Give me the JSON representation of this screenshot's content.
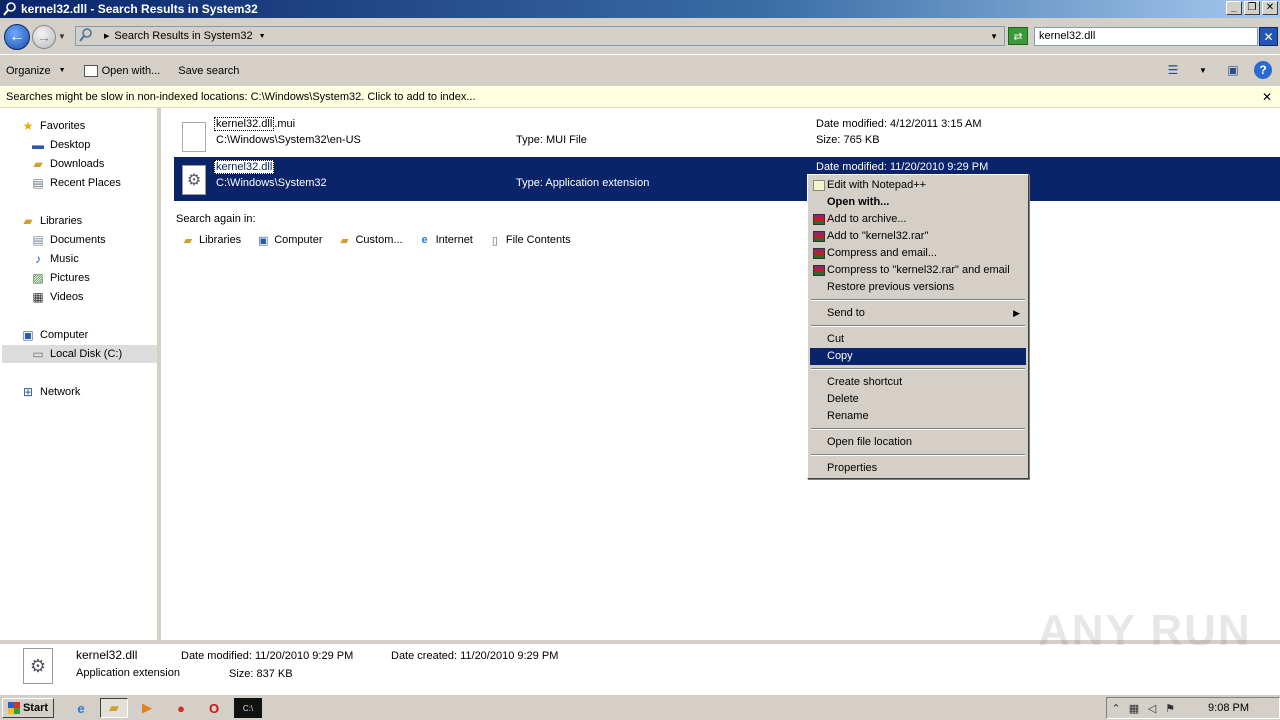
{
  "window": {
    "title": "kernel32.dll - Search Results in System32",
    "buttons": {
      "minimize": "_",
      "maximize": "❐",
      "close": "✕"
    }
  },
  "address": {
    "crumb": "Search Results in System32",
    "search_value": "kernel32.dll"
  },
  "toolbar": {
    "organize": "Organize",
    "open_with": "Open with...",
    "save_search": "Save search"
  },
  "infobar": {
    "text": "Searches might be slow in non-indexed locations: C:\\Windows\\System32. Click to add to index...",
    "close": "✕"
  },
  "nav": {
    "favorites": "Favorites",
    "desktop": "Desktop",
    "downloads": "Downloads",
    "recent_places": "Recent Places",
    "libraries": "Libraries",
    "documents": "Documents",
    "music": "Music",
    "pictures": "Pictures",
    "videos": "Videos",
    "computer": "Computer",
    "local_disk": "Local Disk (C:)",
    "network": "Network"
  },
  "results": [
    {
      "name_match": "kernel32.dll",
      "name_rest": ".mui",
      "path": "C:\\Windows\\System32\\en-US",
      "type": "Type: MUI File",
      "date": "Date modified: 4/12/2011 3:15 AM",
      "size": "Size: 765 KB"
    },
    {
      "name_match": "kernel32.dll",
      "name_rest": "",
      "path": "C:\\Windows\\System32",
      "type": "Type: Application extension",
      "date": "Date modified: 11/20/2010 9:29 PM",
      "size": ""
    }
  ],
  "search_again": {
    "label": "Search again in:",
    "libraries": "Libraries",
    "computer": "Computer",
    "custom": "Custom...",
    "internet": "Internet",
    "file_contents": "File Contents"
  },
  "context_menu": {
    "edit_npp": "Edit with Notepad++",
    "open_with": "Open with...",
    "add_archive": "Add to archive...",
    "add_rar": "Add to \"kernel32.rar\"",
    "compress_email": "Compress and email...",
    "compress_rar_email": "Compress to \"kernel32.rar\" and email",
    "restore": "Restore previous versions",
    "send_to": "Send to",
    "cut": "Cut",
    "copy": "Copy",
    "create_shortcut": "Create shortcut",
    "delete": "Delete",
    "rename": "Rename",
    "open_location": "Open file location",
    "properties": "Properties"
  },
  "details": {
    "name": "kernel32.dll",
    "type": "Application extension",
    "date_modified": "Date modified: 11/20/2010 9:29 PM",
    "size": "Size: 837 KB",
    "date_created": "Date created: 11/20/2010 9:29 PM"
  },
  "taskbar": {
    "start": "Start",
    "clock": "9:08 PM"
  },
  "watermark": "ANY RUN",
  "colors": {
    "selection": "#0a246a",
    "infobar": "#ffffe1",
    "chrome": "#d4d0c8"
  }
}
